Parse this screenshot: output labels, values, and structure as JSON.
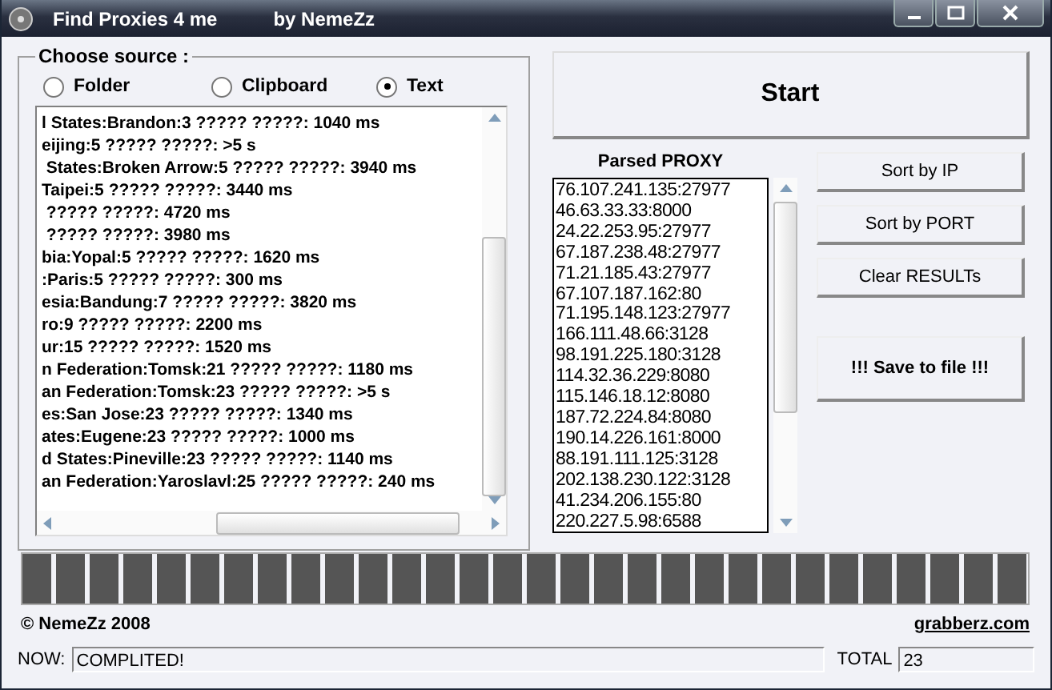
{
  "window": {
    "title": "Find Proxies 4 me",
    "subtitle": "by NemeZz"
  },
  "source": {
    "legend": "Choose source :",
    "options": [
      {
        "label": "Folder",
        "selected": false
      },
      {
        "label": "Clipboard",
        "selected": false
      },
      {
        "label": "Text",
        "selected": true
      }
    ],
    "lines": [
      "l States:Brandon:3 ????? ?????: 1040 ms",
      "eijing:5 ????? ?????: >5 s",
      " States:Broken Arrow:5 ????? ?????: 3940 ms",
      "Taipei:5 ????? ?????: 3440 ms",
      " ????? ?????: 4720 ms",
      " ????? ?????: 3980 ms",
      "bia:Yopal:5 ????? ?????: 1620 ms",
      ":Paris:5 ????? ?????: 300 ms",
      "esia:Bandung:7 ????? ?????: 3820 ms",
      "ro:9 ????? ?????: 2200 ms",
      "ur:15 ????? ?????: 1520 ms",
      "n Federation:Tomsk:21 ????? ?????: 1180 ms",
      "an Federation:Tomsk:23 ????? ?????: >5 s",
      "es:San Jose:23 ????? ?????: 1340 ms",
      "ates:Eugene:23 ????? ?????: 1000 ms",
      "d States:Pineville:23 ????? ?????: 1140 ms",
      "an Federation:Yaroslavl:25 ????? ?????: 240 ms"
    ]
  },
  "start_button": "Start",
  "parsed": {
    "title": "Parsed PROXY",
    "items": [
      "76.107.241.135:27977",
      "46.63.33.33:8000",
      "24.22.253.95:27977",
      "67.187.238.48:27977",
      "71.21.185.43:27977",
      "67.107.187.162:80",
      "71.195.148.123:27977",
      "166.111.48.66:3128",
      "98.191.225.180:3128",
      "114.32.36.229:8080",
      "115.146.18.12:8080",
      "187.72.224.84:8080",
      "190.14.226.161:8000",
      "88.191.111.125:3128",
      "202.138.230.122:3128",
      "41.234.206.155:80",
      "220.227.5.98:6588"
    ]
  },
  "buttons": [
    {
      "label": "Sort by IP",
      "kind": "normal"
    },
    {
      "label": "Sort by PORT",
      "kind": "normal"
    },
    {
      "label": "Clear RESULTs",
      "kind": "normal"
    },
    {
      "label": "!!! Save to file !!!",
      "kind": "big"
    }
  ],
  "progress": {
    "level": 1
  },
  "footer": {
    "copyright": "© NemeZz 2008",
    "link": "grabberz.com"
  },
  "status_bar": {
    "now_label": "NOW:",
    "now_value": "COMPLITED!",
    "total_label": "TOTAL",
    "total_value": "23"
  }
}
